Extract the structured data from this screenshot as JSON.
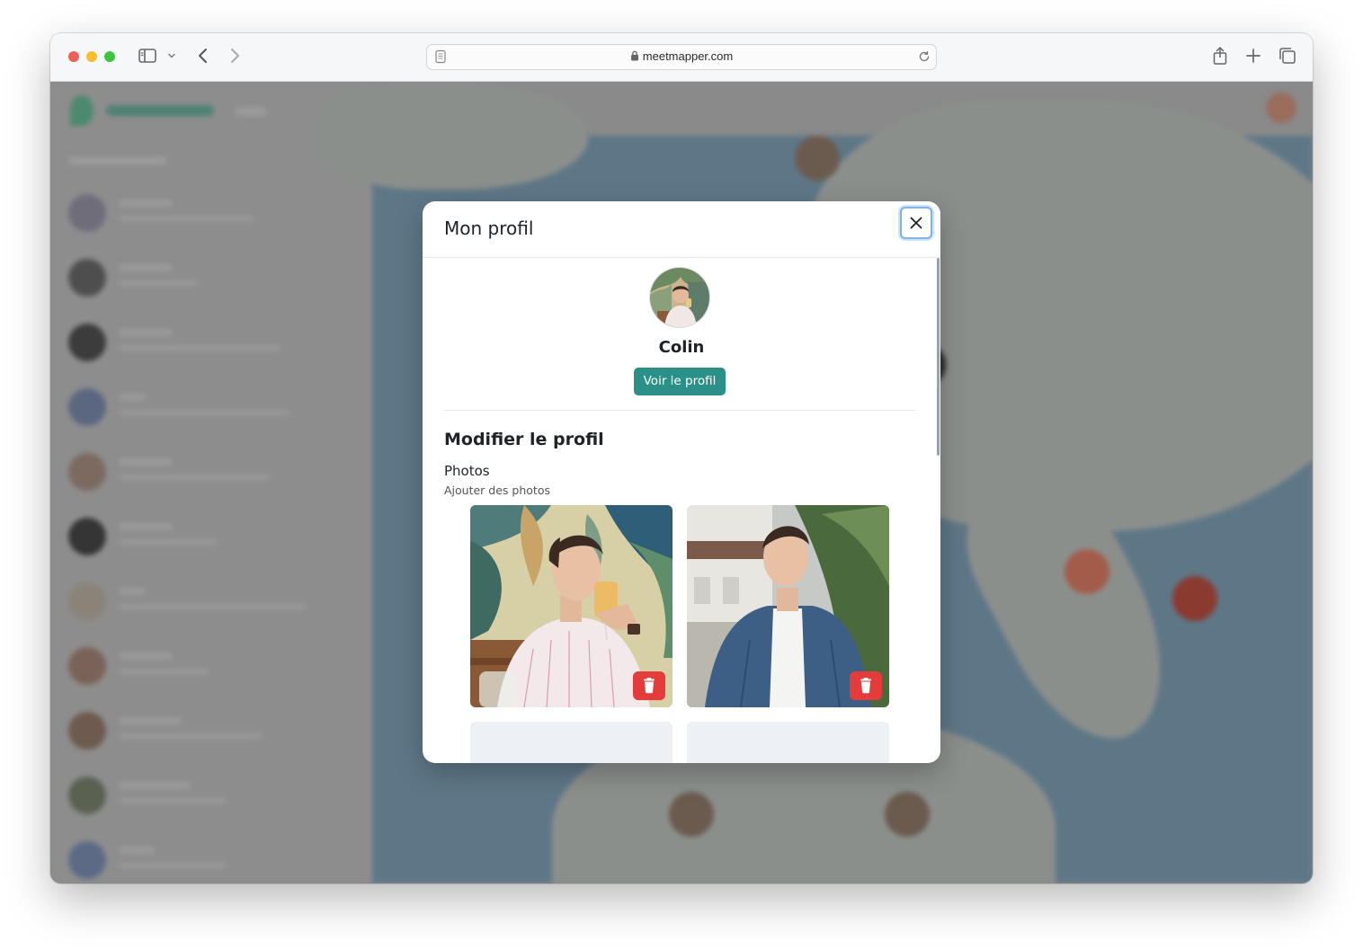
{
  "browser": {
    "url": "meetmapper.com"
  },
  "modal": {
    "title": "Mon profil",
    "profile_name": "Colin",
    "view_profile_button": "Voir le profil",
    "section_title": "Modifier le profil",
    "photos_label": "Photos",
    "photos_hint": "Ajouter des photos"
  },
  "colors": {
    "accent": "#2b9088",
    "delete": "#e43b3b",
    "focus_ring": "#7fb3e8"
  },
  "icons": [
    "sidebar-icon",
    "chevron-down-icon",
    "back-icon",
    "forward-icon",
    "page-icon",
    "lock-icon",
    "reload-icon",
    "share-icon",
    "plus-icon",
    "tabs-icon",
    "close-icon",
    "trash-icon"
  ]
}
